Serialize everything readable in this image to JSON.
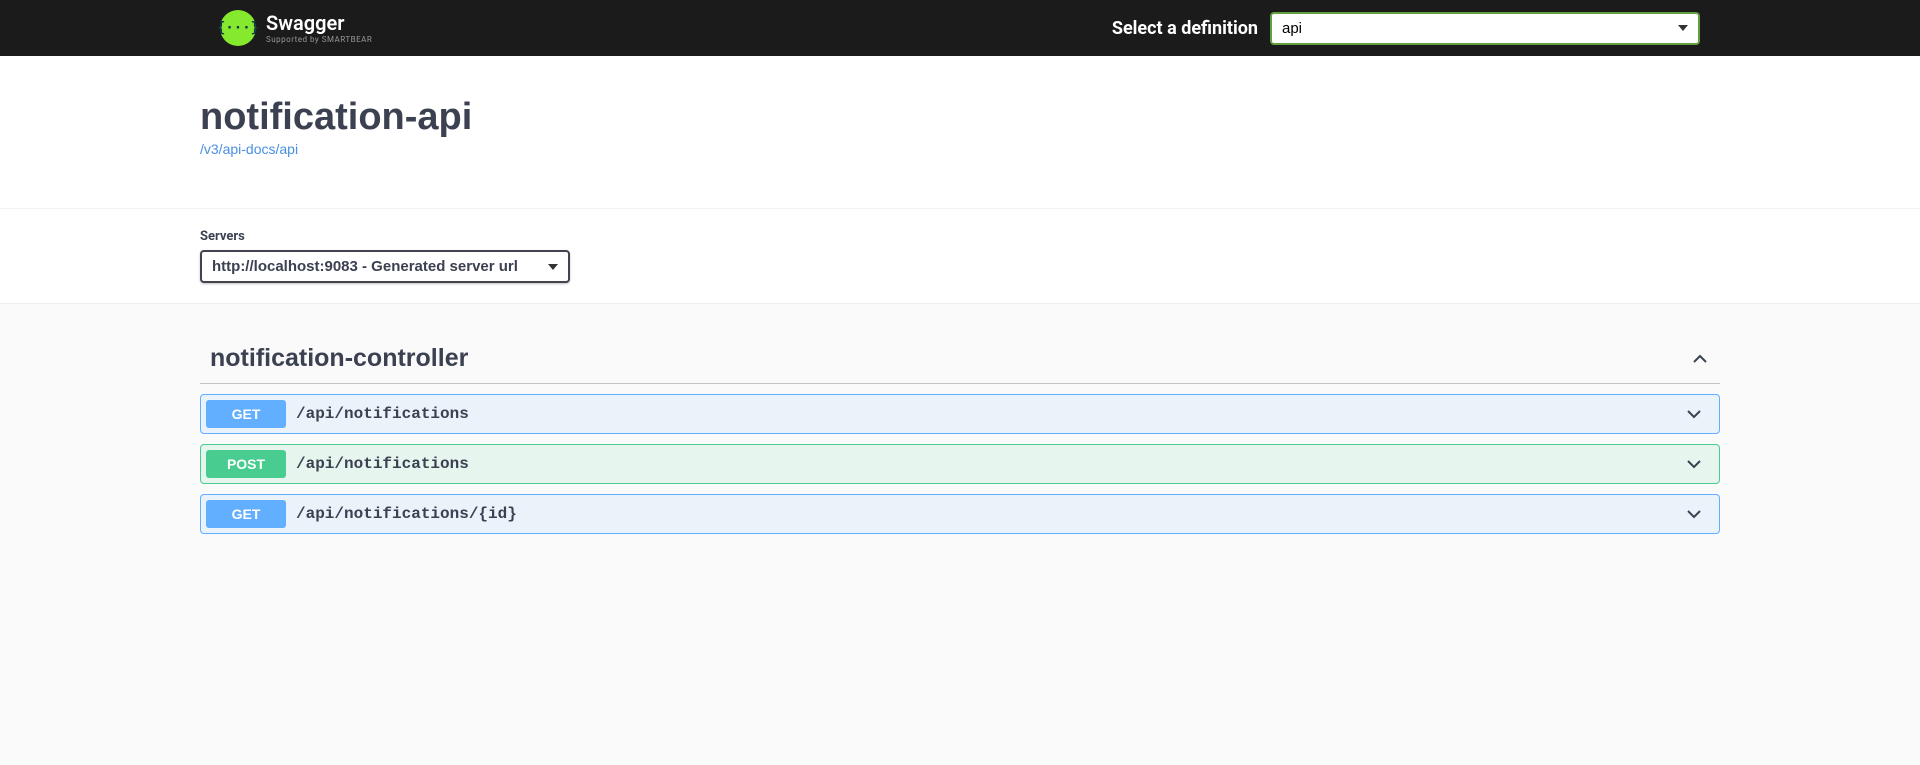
{
  "topbar": {
    "logo_title": "Swagger",
    "logo_subtitle": "Supported by SMARTBEAR",
    "select_label": "Select a definition",
    "definition_value": "api"
  },
  "info": {
    "title": "notification-api",
    "docs_link": "/v3/api-docs/api"
  },
  "servers": {
    "label": "Servers",
    "selected": "http://localhost:9083 - Generated server url"
  },
  "tag": {
    "name": "notification-controller"
  },
  "operations": [
    {
      "method": "GET",
      "path": "/api/notifications"
    },
    {
      "method": "POST",
      "path": "/api/notifications"
    },
    {
      "method": "GET",
      "path": "/api/notifications/{id}"
    }
  ]
}
